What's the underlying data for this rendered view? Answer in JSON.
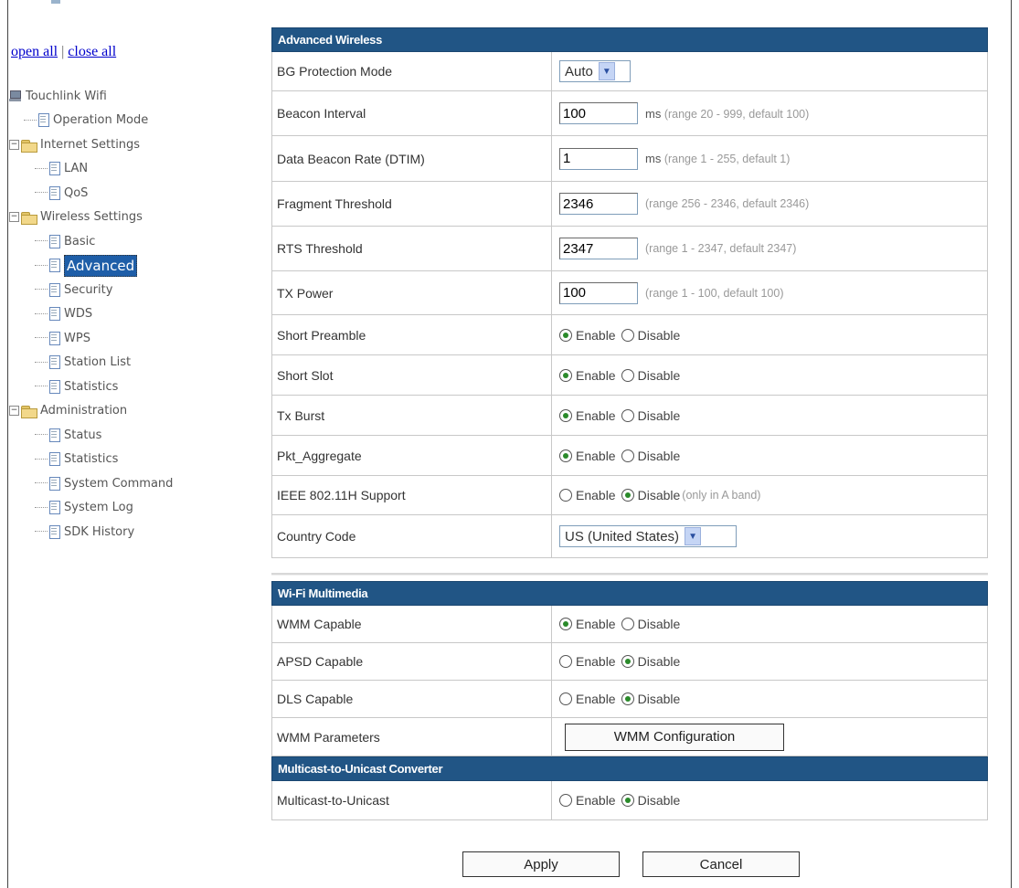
{
  "nav": {
    "open_all": "open all",
    "close_all": "close all",
    "sep": "|",
    "root": "Touchlink Wifi",
    "items": [
      {
        "label": "Operation Mode",
        "level": 1,
        "type": "page"
      },
      {
        "label": "Internet Settings",
        "level": 1,
        "type": "folder"
      },
      {
        "label": "LAN",
        "level": 2,
        "type": "page"
      },
      {
        "label": "QoS",
        "level": 2,
        "type": "page"
      },
      {
        "label": "Wireless Settings",
        "level": 1,
        "type": "folder"
      },
      {
        "label": "Basic",
        "level": 2,
        "type": "page"
      },
      {
        "label": "Advanced",
        "level": 2,
        "type": "page",
        "selected": true
      },
      {
        "label": "Security",
        "level": 2,
        "type": "page"
      },
      {
        "label": "WDS",
        "level": 2,
        "type": "page"
      },
      {
        "label": "WPS",
        "level": 2,
        "type": "page"
      },
      {
        "label": "Station List",
        "level": 2,
        "type": "page"
      },
      {
        "label": "Statistics",
        "level": 2,
        "type": "page"
      },
      {
        "label": "Administration",
        "level": 1,
        "type": "folder"
      },
      {
        "label": "Status",
        "level": 2,
        "type": "page"
      },
      {
        "label": "Statistics",
        "level": 2,
        "type": "page"
      },
      {
        "label": "System Command",
        "level": 2,
        "type": "page"
      },
      {
        "label": "System Log",
        "level": 2,
        "type": "page"
      },
      {
        "label": "SDK History",
        "level": 2,
        "type": "page"
      }
    ]
  },
  "advanced": {
    "title": "Advanced Wireless",
    "bg_protection": {
      "label": "BG Protection Mode",
      "value": "Auto"
    },
    "beacon": {
      "label": "Beacon Interval",
      "value": "100",
      "unit": "ms",
      "hint": "(range 20 - 999, default 100)"
    },
    "dtim": {
      "label": "Data Beacon Rate (DTIM)",
      "value": "1",
      "unit": "ms",
      "hint": "(range 1 - 255, default 1)"
    },
    "fragment": {
      "label": "Fragment Threshold",
      "value": "2346",
      "hint": "(range 256 - 2346, default 2346)"
    },
    "rts": {
      "label": "RTS Threshold",
      "value": "2347",
      "hint": "(range 1 - 2347, default 2347)"
    },
    "txpower": {
      "label": "TX Power",
      "value": "100",
      "hint": "(range 1 - 100, default 100)"
    },
    "short_preamble": {
      "label": "Short Preamble",
      "selected": "Enable"
    },
    "short_slot": {
      "label": "Short Slot",
      "selected": "Enable"
    },
    "tx_burst": {
      "label": "Tx Burst",
      "selected": "Enable"
    },
    "pkt_aggregate": {
      "label": "Pkt_Aggregate",
      "selected": "Enable"
    },
    "ieee80211h": {
      "label": "IEEE 802.11H Support",
      "selected": "Disable",
      "note": "(only in A band)"
    },
    "country": {
      "label": "Country Code",
      "value": "US (United States)"
    }
  },
  "wmm": {
    "title": "Wi-Fi Multimedia",
    "capable": {
      "label": "WMM Capable",
      "selected": "Enable"
    },
    "apsd": {
      "label": "APSD Capable",
      "selected": "Disable"
    },
    "dls": {
      "label": "DLS Capable",
      "selected": "Disable"
    },
    "params": {
      "label": "WMM Parameters",
      "button": "WMM Configuration"
    }
  },
  "m2u": {
    "title": "Multicast-to-Unicast Converter",
    "row": {
      "label": "Multicast-to-Unicast",
      "selected": "Disable"
    }
  },
  "radio_labels": {
    "enable": "Enable",
    "disable": "Disable"
  },
  "actions": {
    "apply": "Apply",
    "cancel": "Cancel"
  },
  "colors": {
    "header_bg": "#215585",
    "selected_bg": "#1e5ea8",
    "radio_dot": "#2a8a2a"
  }
}
